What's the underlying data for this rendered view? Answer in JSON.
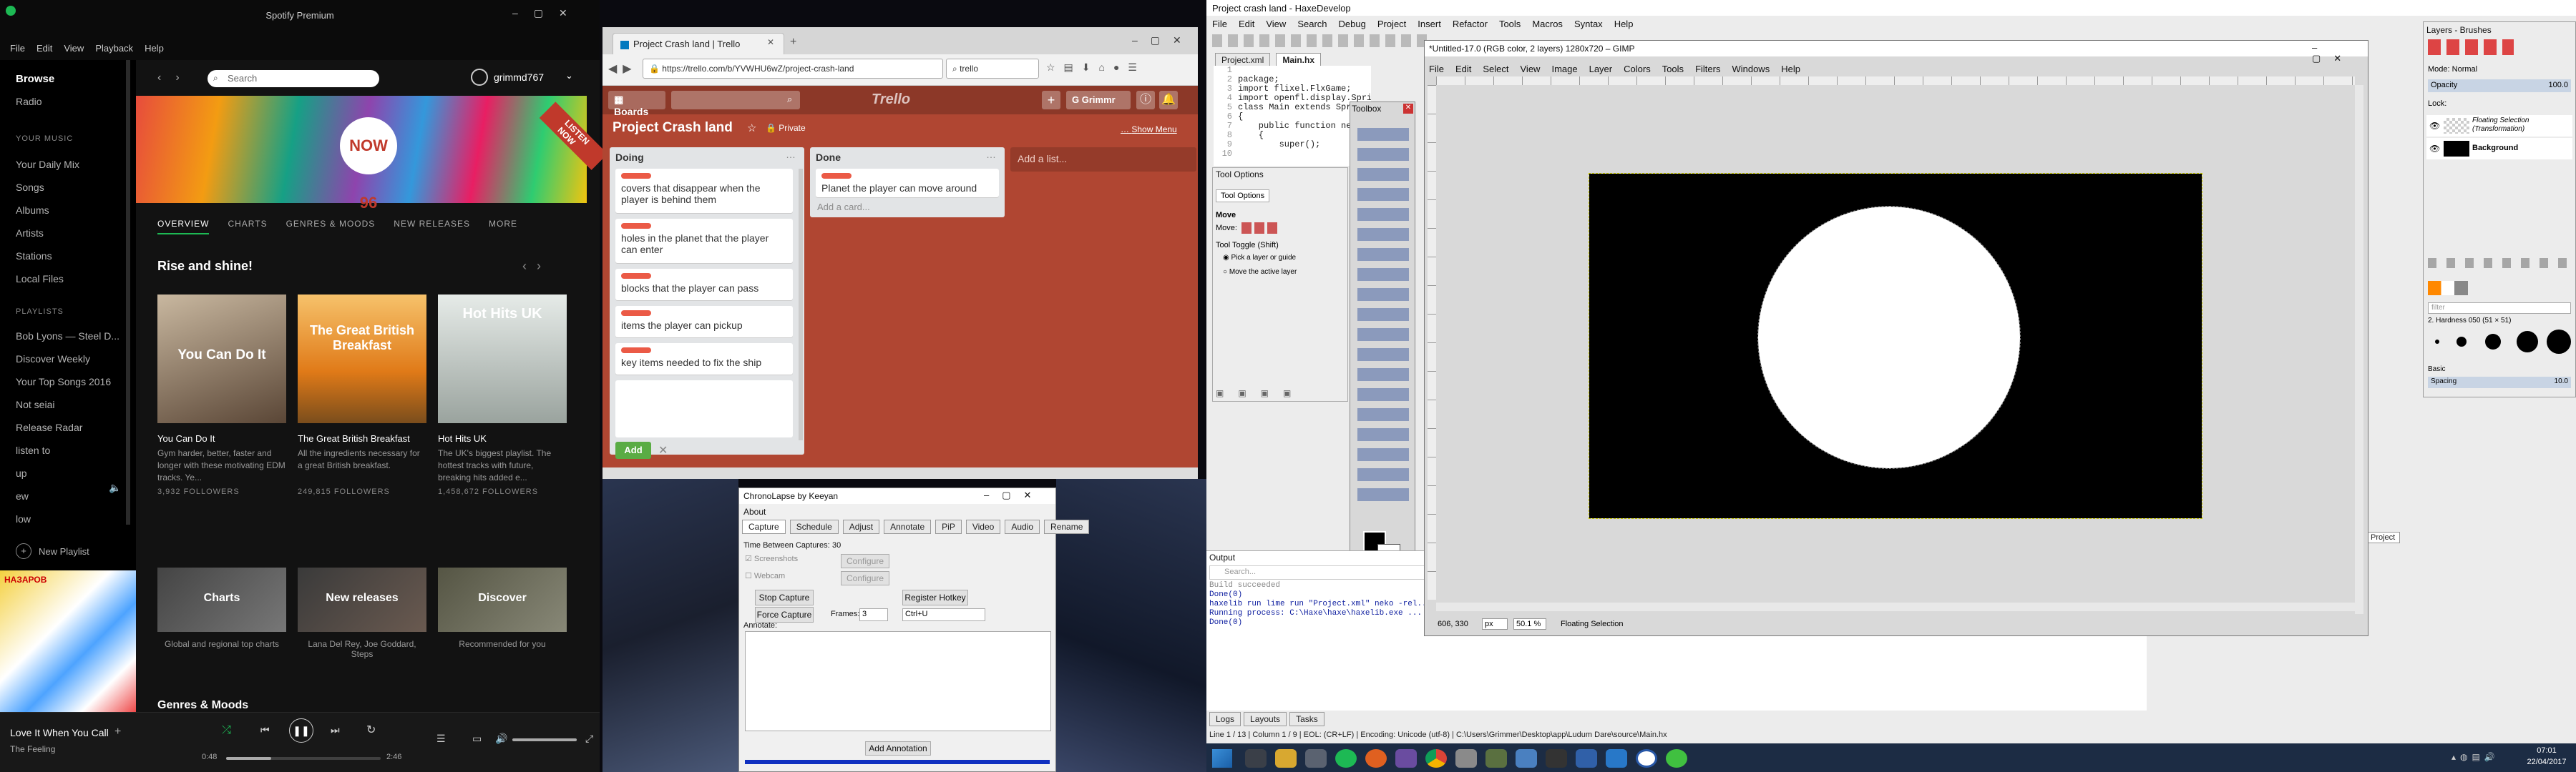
{
  "spotify": {
    "title": "Spotify Premium",
    "menu": [
      "File",
      "Edit",
      "View",
      "Playback",
      "Help"
    ],
    "search_placeholder": "Search",
    "username": "grimmd767",
    "nav": [
      "Browse",
      "Radio"
    ],
    "your_music_heading": "YOUR MUSIC",
    "your_music": [
      "Your Daily Mix",
      "Songs",
      "Albums",
      "Artists",
      "Stations",
      "Local Files"
    ],
    "playlists_heading": "PLAYLISTS",
    "playlists": [
      "Bob Lyons — Steel D...",
      "Discover Weekly",
      "Your Top Songs 2016",
      "Not seiai",
      "Release Radar",
      "listen to",
      "up",
      "ew",
      "low"
    ],
    "new_playlist": "New Playlist",
    "banner_text": "NOW 96",
    "banner_corner": "LISTEN NOW",
    "tabs": [
      "OVERVIEW",
      "CHARTS",
      "GENRES & MOODS",
      "NEW RELEASES",
      "MORE"
    ],
    "section1": "Rise and shine!",
    "cards": [
      {
        "title": "You Can Do It",
        "overlay": "You Can Do It",
        "desc": "Gym harder, better, faster and longer with these motivating EDM tracks. Ye...",
        "followers": "3,932 FOLLOWERS",
        "color": "#5a4636"
      },
      {
        "title": "The Great British Breakfast",
        "overlay": "The Great British Breakfast",
        "desc": "All the ingredients necessary for a great British breakfast.",
        "followers": "249,815 FOLLOWERS",
        "color": "#e07a18"
      },
      {
        "title": "Hot Hits UK",
        "overlay": "Hot Hits UK",
        "desc": "The UK's biggest playlist. The hottest tracks with future, breaking hits added e...",
        "followers": "1,458,672 FOLLOWERS",
        "color": "#cfd6d2"
      }
    ],
    "cards2": [
      {
        "overlay": "Charts",
        "desc": "Global and regional top charts"
      },
      {
        "overlay": "New releases",
        "desc": "Lana Del Rey, Joe Goddard, Steps"
      },
      {
        "overlay": "Discover",
        "desc": "Recommended for you"
      }
    ],
    "section3": "Genres & Moods",
    "now_playing_title": "Love It When You Call",
    "now_playing_artist": "The Feeling",
    "time_elapsed": "0:48",
    "time_total": "2:46",
    "playback_progress": 0.29,
    "album_text": "НАЗАРОВ"
  },
  "trello": {
    "tab_title": "Project Crash land | Trello",
    "url": "https://trello.com/b/YVWHU6wZ/project-crash-land",
    "search_box": "trello",
    "boards_label": "Boards",
    "logo": "Trello",
    "user": "Grimmr",
    "board_title": "Project Crash land",
    "visibility": "Private",
    "show_menu": "Show Menu",
    "lists": [
      {
        "name": "Doing",
        "cards": [
          "covers that disappear when the player is behind them",
          "holes in the planet that the player can enter",
          "blocks that the player can pass",
          "items the player can pickup",
          "key items needed to fix the ship"
        ],
        "add": "Add"
      },
      {
        "name": "Done",
        "cards": [
          "Planet the player can move around"
        ],
        "add": "Add a card..."
      }
    ],
    "add_list": "Add a list..."
  },
  "chrono": {
    "title": "ChronoLapse by Keeyan",
    "menu": "About",
    "tabs": [
      "Capture",
      "Schedule",
      "Adjust",
      "Annotate",
      "PiP",
      "Video",
      "Audio",
      "Rename"
    ],
    "time_between_label": "Time Between Captures:",
    "time_between_value": "30",
    "screenshots_label": "Screenshots",
    "webcam_label": "Webcam",
    "configure": "Configure",
    "stop_capture": "Stop Capture",
    "force_capture": "Force Capture",
    "register_hotkey": "Register Hotkey",
    "frames_label": "Frames:",
    "frames_value": "3",
    "hotkey_value": "Ctrl+U",
    "annotate_label": "Annotate:",
    "add_annotation": "Add Annotation"
  },
  "haxe": {
    "title": "Project crash land - HaxeDevelop",
    "menu": [
      "File",
      "Edit",
      "View",
      "Search",
      "Debug",
      "Project",
      "Insert",
      "Refactor",
      "Tools",
      "Macros",
      "Syntax",
      "Help"
    ],
    "file_tabs": [
      "Project.xml",
      "Main.hx"
    ],
    "code": [
      "package;",
      "",
      "import flixel.FlxGame;",
      "import openfl.display.Sprite;",
      "",
      "class Main extends Sprite",
      "{",
      "    public function new()",
      "    {",
      "        super();"
    ],
    "tool_options_title": "Tool Options",
    "tool_options_tab": "Tool Options",
    "move_label": "Move:",
    "tool_toggle": "Tool Toggle  (Shift)",
    "pick_layer": "Pick a layer or guide",
    "move_active": "Move the active layer",
    "output_title": "Output",
    "output_search": "Search...",
    "output_lines": [
      "Build succeeded",
      "Done(0)",
      "haxelib run lime run \"Project.xml\" neko -rel...",
      "Running process: C:\\Haxe\\haxe\\haxelib.exe ...",
      "Done(0)"
    ],
    "bottom_tabs": [
      "Logs",
      "Layouts",
      "Tasks"
    ],
    "status_bar": "Line 1 / 13 | Column 1 / 9 | EOL: (CR+LF) | Encoding: Unicode (utf-8) | C:\\Users\\Grimmer\\Desktop\\app\\Ludum Dare\\source\\Main.hx",
    "project_tab": "Project"
  },
  "gimp": {
    "title": "*Untitled-17.0 (RGB color, 2 layers) 1280x720 – GIMP",
    "menu": [
      "File",
      "Edit",
      "Select",
      "View",
      "Image",
      "Layer",
      "Colors",
      "Tools",
      "Filters",
      "Windows",
      "Help"
    ],
    "toolbox_title": "Toolbox",
    "coords": "606, 330",
    "unit": "px",
    "zoom": "50.1 %",
    "status": "Floating Selection",
    "layers_title": "Layers - Brushes",
    "mode_label": "Mode: Normal",
    "opacity_label": "Opacity",
    "opacity_value": "100.0",
    "lock_label": "Lock:",
    "layers": [
      "Floating Selection (Transformation)",
      "Background"
    ],
    "brush_name": "2. Hardness 050 (51 × 51)",
    "basic_label": "Basic",
    "spacing_label": "Spacing",
    "spacing_value": "10.0",
    "filter_placeholder": "filter"
  },
  "taskbar": {
    "time": "07:01",
    "date": "22/04/2017"
  }
}
